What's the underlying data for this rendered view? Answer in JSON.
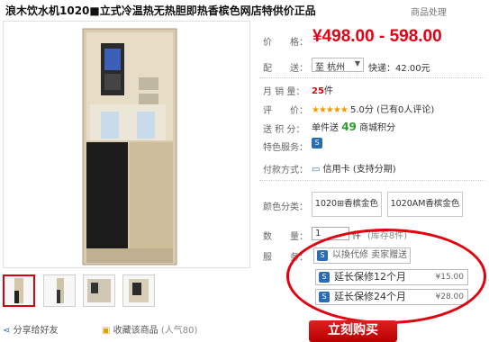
{
  "header": {
    "title": "浪木饮水机1020■立式冷温热无热胆即热香槟色网店特供价正品",
    "right_tag": "商品处理"
  },
  "labels": {
    "price": "价　　格：",
    "delivery": "配　　送：",
    "monthly_sales": "月 销 量：",
    "rating": "评　　价：",
    "points": "送 积 分：",
    "service": "特色服务：",
    "payment": "付款方式：",
    "color": "颜色分类：",
    "quantity": "数　　量：",
    "extra_service": "服　　务："
  },
  "price_range": "¥498.00 - 598.00",
  "delivery": {
    "region_select": "至 杭州",
    "shipping": "快递：42.00元"
  },
  "monthly_sales": {
    "value": "25",
    "unit": "件"
  },
  "rating": {
    "stars": "★★★★★",
    "text": "5.0分 (已有0人评论)"
  },
  "points": {
    "prefix": "单件送",
    "value": "49",
    "suffix": "商城积分"
  },
  "payment": {
    "text": "信用卡 (支持分期)"
  },
  "color_options": [
    "1020⊞香槟金色",
    "1020AM香槟金色"
  ],
  "quantity": {
    "value": "1",
    "unit": "件",
    "stock": "(库存8件)"
  },
  "services": [
    {
      "icon": "S",
      "label": "以換代修  卖家赠送",
      "price": ""
    },
    {
      "icon": "S",
      "label": "延长保修12个月",
      "price": "¥15.00"
    },
    {
      "icon": "S",
      "label": "延长保修24个月",
      "price": "¥28.00"
    }
  ],
  "buy_button": "立刻购买",
  "share_text": "分享给好友",
  "favorite": {
    "text": "收藏该商品",
    "count": "(人气80)"
  },
  "colors": {
    "accent": "#e60012",
    "points": "#2e9a2e",
    "highlight": "#e3000f"
  }
}
